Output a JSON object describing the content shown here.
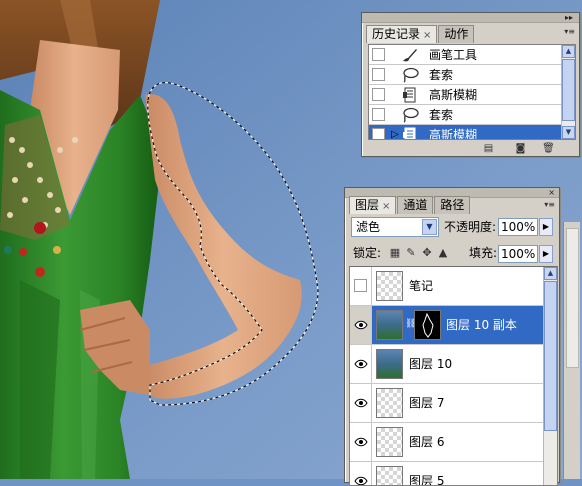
{
  "colors": {
    "canvas_background": "#6f93c4",
    "selection_highlight": "#316ac5",
    "panel_background": "#d4d0c8",
    "dress_green": "#2f8a2b"
  },
  "canvas": {
    "subject": "woman in green dress with lasso selection around arm",
    "selection_type": "marching-ants"
  },
  "history_panel": {
    "tabs": [
      {
        "label": "历史记录",
        "has_close": true,
        "active": true
      },
      {
        "label": "动作",
        "has_close": false,
        "active": false
      }
    ],
    "items": [
      {
        "label": "画笔工具",
        "icon": "brush-icon",
        "selected": false,
        "current": false
      },
      {
        "label": "套索",
        "icon": "lasso-icon",
        "selected": false,
        "current": false
      },
      {
        "label": "高斯模糊",
        "icon": "filter-document-icon",
        "selected": false,
        "current": false
      },
      {
        "label": "套索",
        "icon": "lasso-icon",
        "selected": false,
        "current": false
      },
      {
        "label": "高斯模糊",
        "icon": "filter-document-icon",
        "selected": true,
        "current": true
      }
    ],
    "footer_icons": [
      "new-document-from-state-icon",
      "snapshot-camera-icon",
      "trash-icon"
    ]
  },
  "layers_panel": {
    "tabs": [
      {
        "label": "图层",
        "has_close": true,
        "active": true
      },
      {
        "label": "通道",
        "has_close": false,
        "active": false
      },
      {
        "label": "路径",
        "has_close": false,
        "active": false
      }
    ],
    "blend_mode": "滤色",
    "opacity_label": "不透明度:",
    "opacity_value": "100%",
    "lock_label": "锁定:",
    "lock_icons": [
      "lock-transparent-icon",
      "lock-paint-icon",
      "lock-move-icon",
      "lock-all-icon"
    ],
    "fill_label": "填充:",
    "fill_value": "100%",
    "layers": [
      {
        "name": "笔记",
        "visible": false,
        "thumb": "transparent",
        "has_mask": false,
        "selected": false
      },
      {
        "name": "图层 10 副本",
        "visible": true,
        "thumb": "photo",
        "has_mask": true,
        "selected": true
      },
      {
        "name": "图层 10",
        "visible": true,
        "thumb": "photo",
        "has_mask": false,
        "selected": false
      },
      {
        "name": "图层 7",
        "visible": true,
        "thumb": "transparent",
        "has_mask": false,
        "selected": false
      },
      {
        "name": "图层 6",
        "visible": true,
        "thumb": "transparent",
        "has_mask": false,
        "selected": false
      },
      {
        "name": "图层 5",
        "visible": true,
        "thumb": "transparent",
        "has_mask": false,
        "selected": false
      }
    ]
  }
}
